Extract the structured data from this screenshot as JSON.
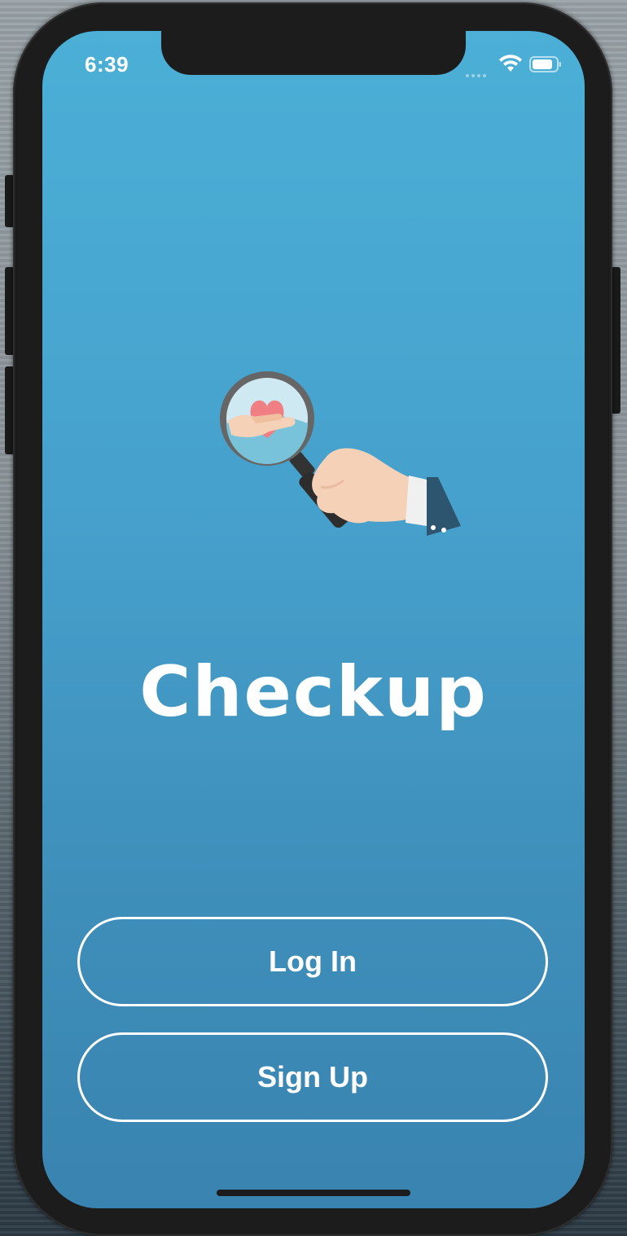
{
  "status_bar": {
    "time": "6:39",
    "icons": [
      "cellular-signal-icon",
      "wifi-icon",
      "battery-icon"
    ]
  },
  "app": {
    "title": "Checkup",
    "logo_icon": "magnifier-hand-heart-icon"
  },
  "buttons": {
    "login_label": "Log In",
    "signup_label": "Sign Up"
  },
  "colors": {
    "background_top": "#4bafd6",
    "background_bottom": "#3983b0",
    "button_border": "#ffffff",
    "text": "#ffffff"
  }
}
